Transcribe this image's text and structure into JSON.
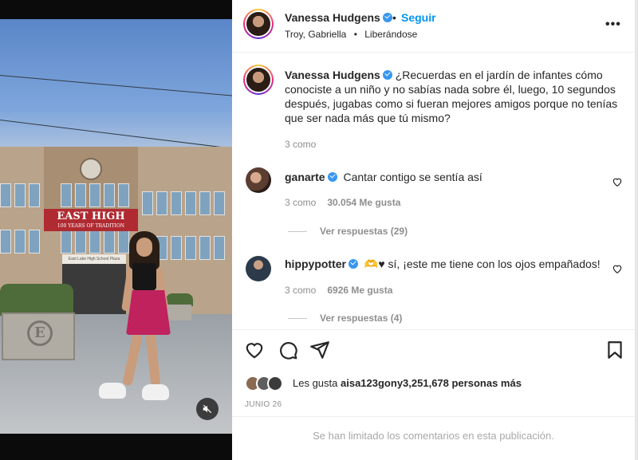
{
  "post": {
    "username": "Vanessa Hudgens",
    "follow_label": "Seguir",
    "separator": "•",
    "tagged": "Troy, Gabriella",
    "sub_separator": "•",
    "audio": "Liberándose",
    "more_icon": "more-horizontal-icon",
    "more_label": "•••"
  },
  "caption": {
    "username": "Vanessa Hudgens",
    "text": "¿Recuerdas en el jardín de infantes cómo conociste a un niño y no sabías nada sobre él, luego, 10 segundos después, jugabas como si fueran mejores amigos porque no tenías que ser nada más que tú mismo?",
    "meta": "3 como"
  },
  "comments": [
    {
      "username": "ganarte",
      "text": "Cantar contigo se sentía así",
      "time": "3 como",
      "likes": "30.054 Me gusta",
      "replies": "Ver respuestas (29)"
    },
    {
      "username": "hippypotter",
      "text": "🫶♥ sí, ¡este me tiene con los ojos empañados!",
      "time": "3 como",
      "likes": "6926 Me gusta",
      "replies": "Ver respuestas (4)"
    }
  ],
  "likes": {
    "prefix": "Les gusta",
    "users": "aisa123gony",
    "count_text": "3,251,678 personas más"
  },
  "date": "JUNIO 26",
  "comments_limited": "Se han limitado los comentarios en esta publicación.",
  "photo": {
    "sign_title": "EAST HIGH",
    "sign_subtitle": "100 YEARS OF TRADITION",
    "entry_sign": "East Lake High School Plaza",
    "planter_letter": "E"
  },
  "colors": {
    "accent": "#0095f6",
    "verified": "#3897f0",
    "text": "#262626",
    "muted": "#8e8e8e"
  }
}
